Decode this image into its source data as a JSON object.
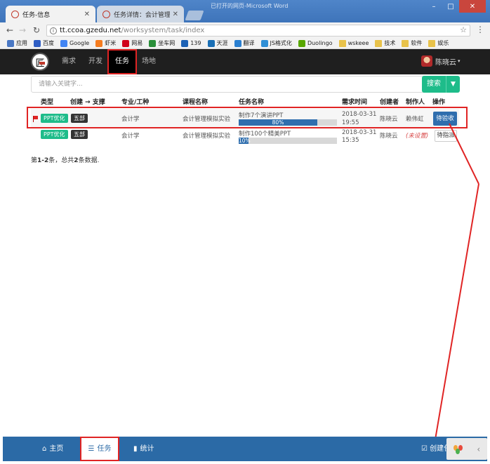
{
  "browser": {
    "tabs": [
      {
        "title": "任务-信息",
        "active": true
      },
      {
        "title": "任务详情：会计管理模拟",
        "active": false
      }
    ],
    "window_title": "已打开的网页-Microsoft Word",
    "url_host": "tt.ccoa.gzedu.net",
    "url_path": "/worksystem/task/index",
    "bookmarks": [
      {
        "label": "应用",
        "icon": "apps-grid-icon",
        "color": "#4a78c4"
      },
      {
        "label": "百度",
        "icon": "baidu-paw-icon",
        "color": "#2f5ec4"
      },
      {
        "label": "Google",
        "icon": "google-g-icon",
        "color": "#4285f4"
      },
      {
        "label": "虾米",
        "icon": "xiami-icon",
        "color": "#f57c1f"
      },
      {
        "label": "网易",
        "icon": "netease-icon",
        "color": "#d0021b"
      },
      {
        "label": "坐车网",
        "icon": "bus-icon",
        "color": "#2a8f3a"
      },
      {
        "label": "139",
        "icon": "mail139-icon",
        "color": "#1d62b5"
      },
      {
        "label": "天涯",
        "icon": "tianya-icon",
        "color": "#1a6fb5"
      },
      {
        "label": "翻译",
        "icon": "translate-icon",
        "color": "#2a7fd0"
      },
      {
        "label": "JS格式化",
        "icon": "js-format-icon",
        "color": "#2f8fd6"
      },
      {
        "label": "Duolingo",
        "icon": "duolingo-owl-icon",
        "color": "#58a700"
      },
      {
        "label": "wskeee",
        "icon": "folder-icon",
        "color": "#e8c24a"
      },
      {
        "label": "技术",
        "icon": "folder-icon",
        "color": "#e8c24a"
      },
      {
        "label": "软件",
        "icon": "folder-icon",
        "color": "#e8c24a"
      },
      {
        "label": "娱乐",
        "icon": "folder-icon",
        "color": "#e8c24a"
      }
    ]
  },
  "nav": {
    "items": [
      {
        "label": "需求",
        "active": false
      },
      {
        "label": "开发",
        "active": false
      },
      {
        "label": "任务",
        "active": true
      },
      {
        "label": "场地",
        "active": false
      }
    ],
    "user_name": "陈晓云"
  },
  "search": {
    "placeholder": "请输入关键字...",
    "button_label": "搜索"
  },
  "table": {
    "headers": [
      "类型",
      "创建 → 支撑",
      "专业/工种",
      "课程名称",
      "任务名称",
      "需求时间",
      "创建者",
      "制作人",
      "操作"
    ],
    "rows": [
      {
        "flagged": true,
        "type": "PPT优化",
        "dept": "五部",
        "major": "会计学",
        "course": "会计管理模拟实验",
        "task": "制作7个演讲PPT",
        "progress": 80,
        "progress_label": "80%",
        "date": "2018-03-31",
        "time": "19:55",
        "creator": "陈晓云",
        "maker": "赖伟虹",
        "maker_unset": false,
        "action": "待验收",
        "action_style": "primary"
      },
      {
        "flagged": false,
        "type": "PPT优化",
        "dept": "五部",
        "major": "会计学",
        "course": "会计管理模拟实验",
        "task": "制作100个精美PPT",
        "progress": 10,
        "progress_label": "10%",
        "date": "2018-03-31",
        "time": "15:35",
        "creator": "陈晓云",
        "maker": "(未设置)",
        "maker_unset": true,
        "action": "待指派",
        "action_style": "default"
      }
    ]
  },
  "summary": {
    "prefix": "第",
    "range": "1-2",
    "middle": "条，总共",
    "total": "2",
    "suffix": "条数据."
  },
  "footer": {
    "home_label": "主页",
    "task_label": "任务",
    "stats_label": "统计",
    "create_label": "创建任务"
  },
  "colors": {
    "accent_green": "#1ebc8a",
    "primary_blue": "#2f6eae",
    "footer_blue": "#2b6aa6",
    "annotation_red": "#e02424",
    "navbar_dark": "#1f1f1f"
  }
}
